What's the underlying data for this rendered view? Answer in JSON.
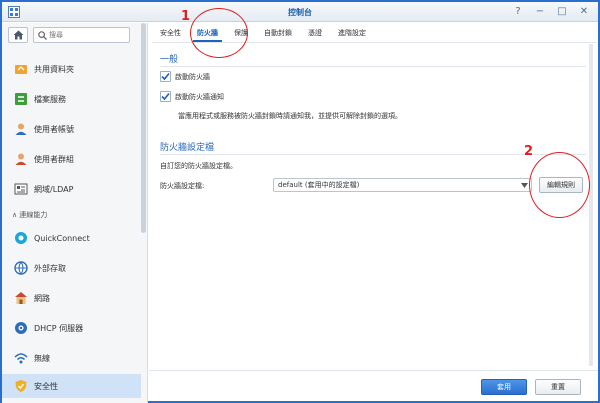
{
  "window": {
    "title": "控制台"
  },
  "sidebar": {
    "search_placeholder": "搜尋",
    "items": [
      {
        "label": "共用資料夾",
        "icon": "share-folder-icon"
      },
      {
        "label": "檔案服務",
        "icon": "file-service-icon"
      },
      {
        "label": "使用者帳號",
        "icon": "user-icon"
      },
      {
        "label": "使用者群組",
        "icon": "user-group-icon"
      },
      {
        "label": "網域/LDAP",
        "icon": "domain-icon"
      }
    ],
    "section": "連線能力",
    "conn_items": [
      {
        "label": "QuickConnect",
        "icon": "quickconnect-icon"
      },
      {
        "label": "外部存取",
        "icon": "external-access-icon"
      },
      {
        "label": "網路",
        "icon": "network-icon"
      },
      {
        "label": "DHCP 伺服器",
        "icon": "dhcp-icon"
      },
      {
        "label": "無線",
        "icon": "wireless-icon"
      },
      {
        "label": "安全性",
        "icon": "security-icon"
      }
    ]
  },
  "tabs": [
    "安全性",
    "防火牆",
    "保護",
    "自動封鎖",
    "憑證",
    "進階設定"
  ],
  "general": {
    "title": "一般",
    "enable_firewall": "啟動防火牆",
    "enable_notify": "啟動防火牆通知",
    "note": "當應用程式或服務被防火牆封鎖時請通知我，並提供可解除封鎖的選項。"
  },
  "profile": {
    "title": "防火牆設定檔",
    "desc": "自訂您的防火牆設定檔。",
    "label": "防火牆設定檔:",
    "selected": "default (套用中的設定檔)",
    "edit_rules": "編輯規則"
  },
  "footer": {
    "apply": "套用",
    "reset": "重置"
  },
  "annotations": {
    "one": "1",
    "two": "2"
  }
}
